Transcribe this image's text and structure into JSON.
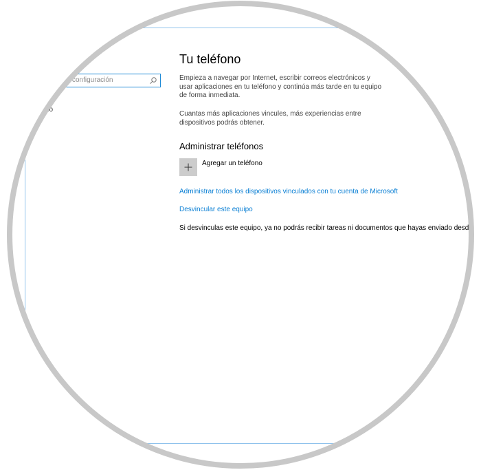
{
  "search": {
    "placeholder": "configuración"
  },
  "sidebar": {
    "partial_item": "no"
  },
  "main": {
    "title": "Tu teléfono",
    "intro_paragraph_1": "Empieza a navegar por Internet, escribir correos electrónicos y usar aplicaciones en tu teléfono y continúa más tarde en tu equipo de forma inmediata.",
    "intro_paragraph_2": "Cuantas más aplicaciones vincules, más experiencias entre dispositivos podrás obtener.",
    "section_title": "Administrar teléfonos",
    "add_phone_label": "Agregar un teléfono",
    "link_manage_devices": "Administrar todos los dispositivos vinculados con tu cuenta de Microsoft",
    "link_unlink": "Desvincular este equipo",
    "warning_text": "Si desvinculas este equipo, ya no podrás recibir tareas ni documentos que hayas enviado desde tu"
  },
  "colors": {
    "accent": "#0a7fd4",
    "frame": "#8fc2ec",
    "ring": "#c8c8c8",
    "tile": "#cccccc"
  },
  "icons": {
    "search": "search-icon",
    "add": "plus-icon"
  }
}
